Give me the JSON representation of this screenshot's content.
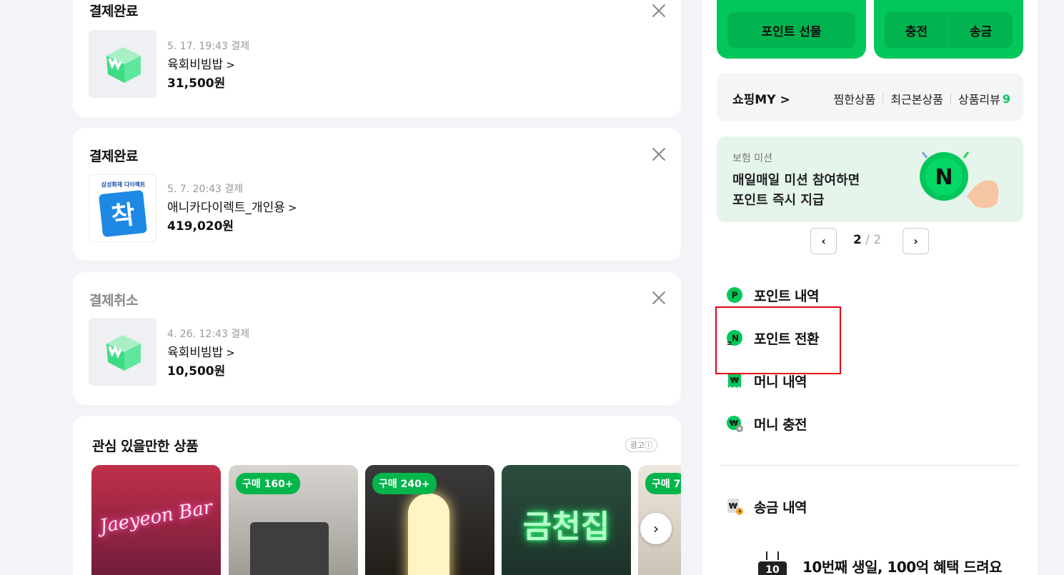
{
  "orders": [
    {
      "status": "결제완료",
      "date": "5. 17. 19:43 결제",
      "name": "육회비빔밥",
      "price": "31,500원"
    },
    {
      "status": "결제완료",
      "date": "5. 7. 20:43 결제",
      "name": "애니카다이렉트_개인용",
      "price": "419,020원",
      "thumb_caption": "삼성화재 다이렉트",
      "thumb_letter": "착"
    },
    {
      "status": "결제취소",
      "date": "4. 26. 12:43 결제",
      "name": "육회비빔밥",
      "price": "10,500원"
    }
  ],
  "chevron": ">",
  "recommend": {
    "title": "관심 있을만한 상품",
    "ad_label": "광고ⓘ",
    "products": [
      {
        "badge": "",
        "art_text": "Jaeyeon Bar"
      },
      {
        "badge": "구매 160+"
      },
      {
        "badge": "구매 240+"
      },
      {
        "badge": "",
        "art_text": "금천집"
      },
      {
        "badge": "구매 7"
      }
    ],
    "next_icon": "›"
  },
  "side": {
    "buttons": {
      "gift": "포인트 선물",
      "charge": "충전",
      "send": "송금"
    },
    "shopping_my": {
      "title": "쇼핑MY",
      "links": [
        "찜한상품",
        "최근본상품",
        "상품리뷰"
      ],
      "review_count": "9"
    },
    "mission": {
      "sub": "보험 미션",
      "line1": "매일매일 미션 참여하면",
      "line2": "포인트 즉시 지급"
    },
    "pager": {
      "current": "2",
      "total": "2",
      "prev": "‹",
      "next": "›"
    },
    "menu": [
      "포인트 내역",
      "포인트 전환",
      "머니 내역",
      "머니 충전",
      "송금 내역"
    ],
    "anniversary": "10번째 생일, 100억 혜택 드려요"
  },
  "colors": {
    "brand": "#03c75a",
    "highlight": "#e60012"
  }
}
